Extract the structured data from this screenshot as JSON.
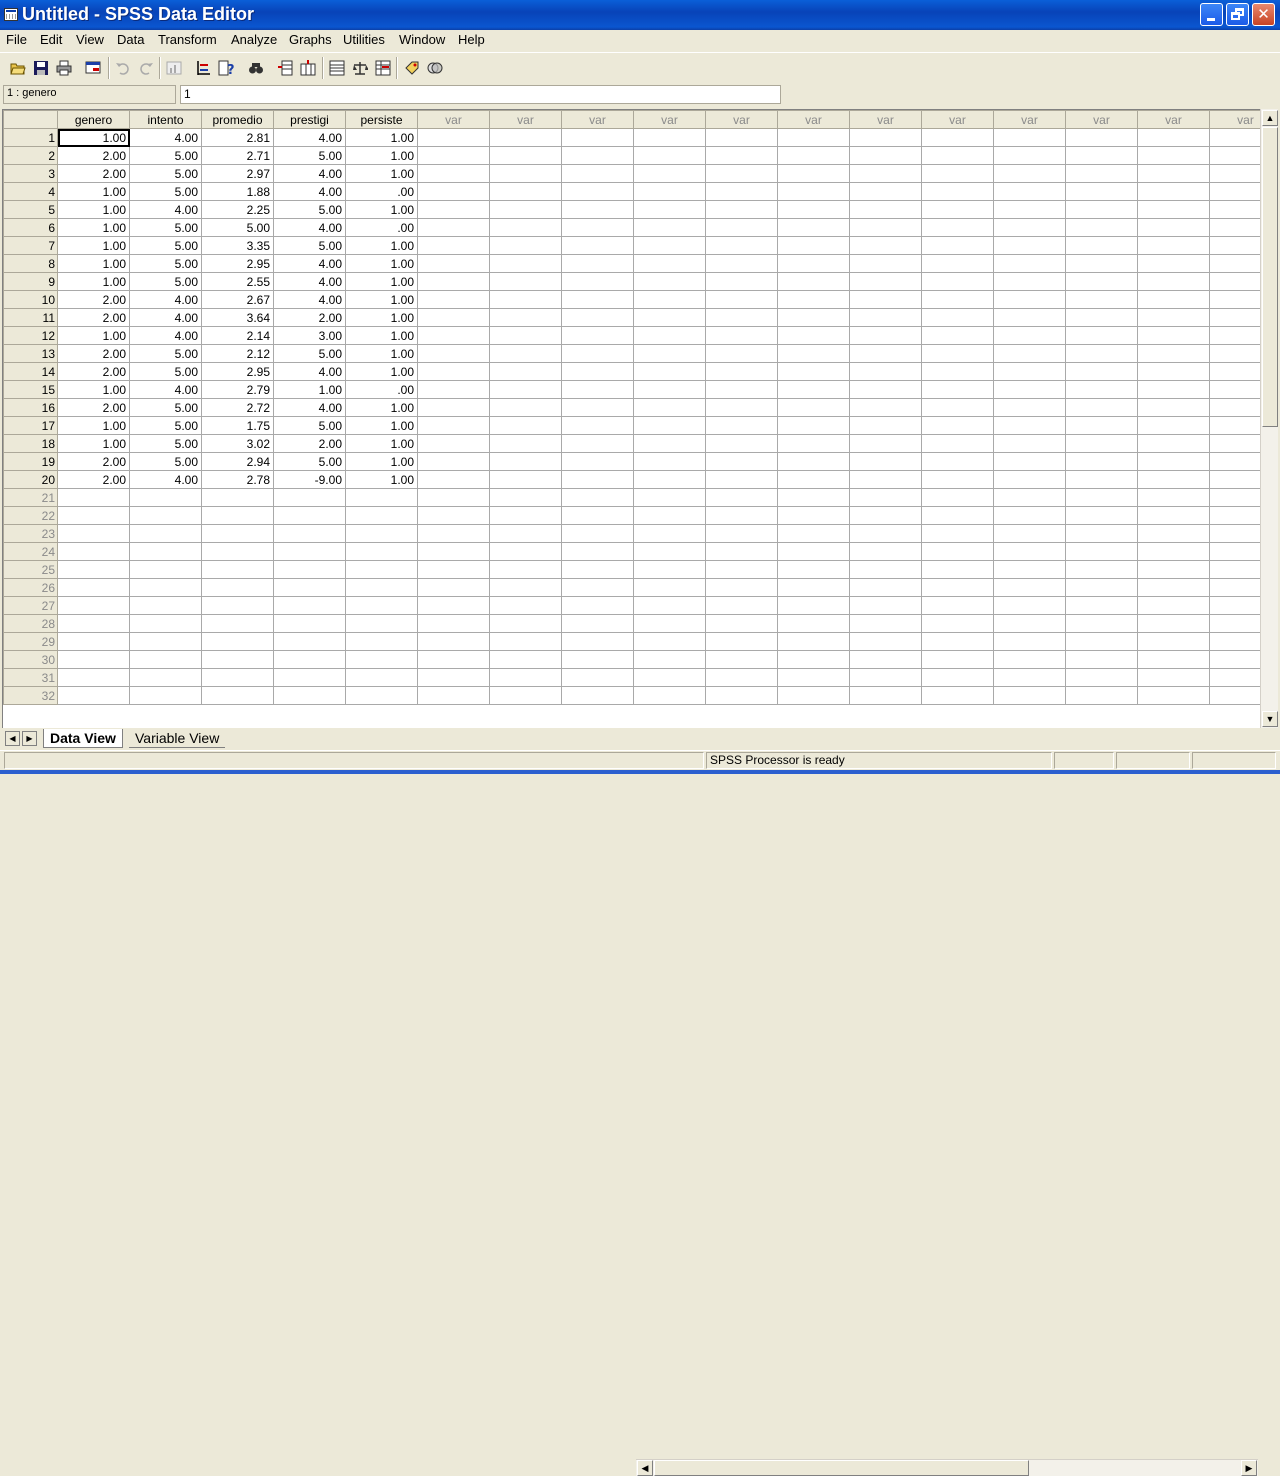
{
  "window": {
    "title": "Untitled - SPSS Data Editor"
  },
  "menu": [
    "File",
    "Edit",
    "View",
    "Data",
    "Transform",
    "Analyze",
    "Graphs",
    "Utilities",
    "Window",
    "Help"
  ],
  "toolbar": {
    "buttons": [
      "open-icon",
      "save-icon",
      "print-icon",
      "dialog-recall-icon",
      "undo-icon",
      "redo-icon",
      "goto-chart-icon",
      "goto-case-icon",
      "variables-icon",
      "find-icon",
      "insert-cases-icon",
      "insert-variable-icon",
      "split-file-icon",
      "weight-cases-icon",
      "select-cases-icon",
      "value-labels-icon",
      "use-sets-icon"
    ]
  },
  "editor": {
    "cell_ref": "1 : genero",
    "value": "1"
  },
  "grid": {
    "columns": [
      "genero",
      "intento",
      "promedio",
      "prestigi",
      "persiste",
      "var",
      "var",
      "var",
      "var",
      "var",
      "var",
      "var",
      "var",
      "var",
      "var",
      "var",
      "var"
    ],
    "rows": [
      [
        "1.00",
        "4.00",
        "2.81",
        "4.00",
        "1.00"
      ],
      [
        "2.00",
        "5.00",
        "2.71",
        "5.00",
        "1.00"
      ],
      [
        "2.00",
        "5.00",
        "2.97",
        "4.00",
        "1.00"
      ],
      [
        "1.00",
        "5.00",
        "1.88",
        "4.00",
        ".00"
      ],
      [
        "1.00",
        "4.00",
        "2.25",
        "5.00",
        "1.00"
      ],
      [
        "1.00",
        "5.00",
        "5.00",
        "4.00",
        ".00"
      ],
      [
        "1.00",
        "5.00",
        "3.35",
        "5.00",
        "1.00"
      ],
      [
        "1.00",
        "5.00",
        "2.95",
        "4.00",
        "1.00"
      ],
      [
        "1.00",
        "5.00",
        "2.55",
        "4.00",
        "1.00"
      ],
      [
        "2.00",
        "4.00",
        "2.67",
        "4.00",
        "1.00"
      ],
      [
        "2.00",
        "4.00",
        "3.64",
        "2.00",
        "1.00"
      ],
      [
        "1.00",
        "4.00",
        "2.14",
        "3.00",
        "1.00"
      ],
      [
        "2.00",
        "5.00",
        "2.12",
        "5.00",
        "1.00"
      ],
      [
        "2.00",
        "5.00",
        "2.95",
        "4.00",
        "1.00"
      ],
      [
        "1.00",
        "4.00",
        "2.79",
        "1.00",
        ".00"
      ],
      [
        "2.00",
        "5.00",
        "2.72",
        "4.00",
        "1.00"
      ],
      [
        "1.00",
        "5.00",
        "1.75",
        "5.00",
        "1.00"
      ],
      [
        "1.00",
        "5.00",
        "3.02",
        "2.00",
        "1.00"
      ],
      [
        "2.00",
        "5.00",
        "2.94",
        "5.00",
        "1.00"
      ],
      [
        "2.00",
        "4.00",
        "2.78",
        "-9.00",
        "1.00"
      ]
    ],
    "total_rows": 32
  },
  "tabs": {
    "data_view": "Data View",
    "variable_view": "Variable View"
  },
  "status": {
    "processor": "SPSS Processor  is ready"
  }
}
